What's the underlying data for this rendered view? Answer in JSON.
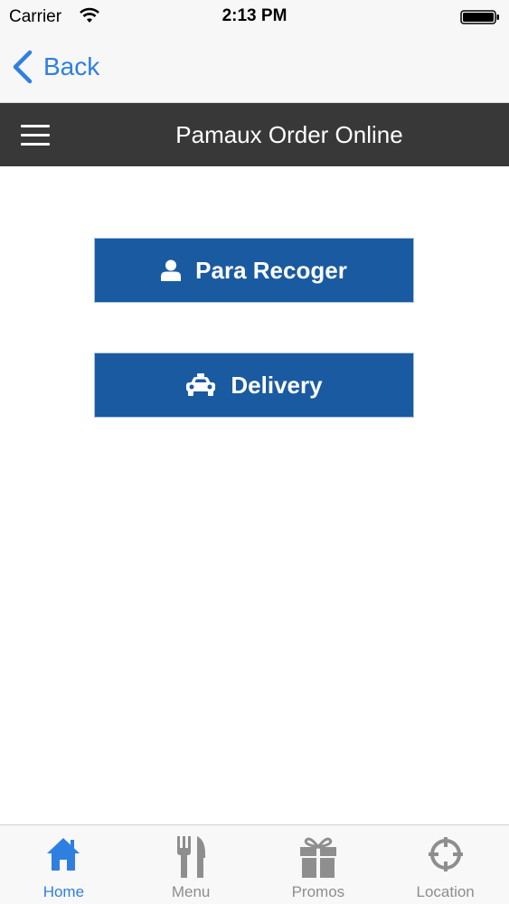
{
  "status_bar": {
    "carrier": "Carrier",
    "time": "2:13 PM"
  },
  "nav": {
    "back_label": "Back"
  },
  "header": {
    "title": "Pamaux Order Online"
  },
  "actions": {
    "pickup_label": "Para Recoger",
    "delivery_label": "Delivery"
  },
  "tabs": [
    {
      "label": "Home",
      "icon": "home-icon",
      "active": true
    },
    {
      "label": "Menu",
      "icon": "fork-knife-icon",
      "active": false
    },
    {
      "label": "Promos",
      "icon": "gift-icon",
      "active": false
    },
    {
      "label": "Location",
      "icon": "crosshair-icon",
      "active": false
    }
  ],
  "colors": {
    "accent": "#2f7fe0",
    "button_bg": "#1a5aa0",
    "header_bg": "#383838",
    "tab_inactive": "#8e8e8e"
  }
}
